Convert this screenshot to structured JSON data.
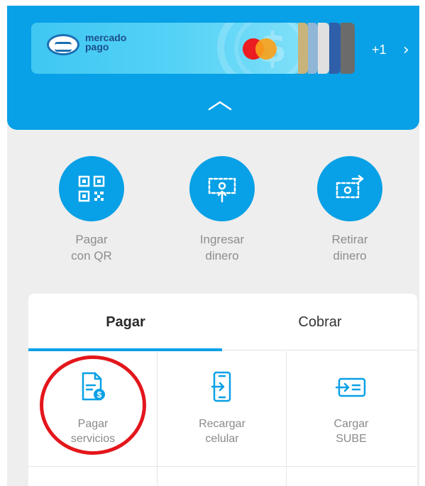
{
  "card": {
    "brand_line1": "mercado",
    "brand_line2": "pago",
    "extra_cards": "+1",
    "stack_colors": [
      "#c8b47a",
      "#8fb6d6",
      "#e0e0e0",
      "#2f5fa8",
      "#6b6b6b"
    ]
  },
  "quick_actions": [
    {
      "label": "Pagar\ncon QR",
      "icon": "qr-code-icon"
    },
    {
      "label": "Ingresar\ndinero",
      "icon": "deposit-money-icon"
    },
    {
      "label": "Retirar\ndinero",
      "icon": "withdraw-money-icon"
    }
  ],
  "tabs": [
    {
      "label": "Pagar",
      "active": true
    },
    {
      "label": "Cobrar",
      "active": false
    }
  ],
  "services": [
    {
      "label": "Pagar\nservicios",
      "icon": "bill-icon"
    },
    {
      "label": "Recargar\ncelular",
      "icon": "phone-topup-icon"
    },
    {
      "label": "Cargar\nSUBE",
      "icon": "transport-card-icon"
    }
  ],
  "colors": {
    "accent": "#08a0e6",
    "highlight_circle": "#e3161b"
  }
}
